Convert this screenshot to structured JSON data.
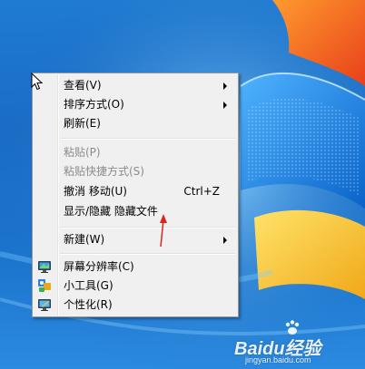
{
  "context_menu": {
    "items": [
      {
        "label": "查看(V)",
        "submenu": true
      },
      {
        "label": "排序方式(O)",
        "submenu": true
      },
      {
        "label": "刷新(E)"
      },
      {
        "label": "粘贴(P)",
        "disabled": true
      },
      {
        "label": "粘贴快捷方式(S)",
        "disabled": true
      },
      {
        "label": "撤消 移动(U)",
        "shortcut": "Ctrl+Z"
      },
      {
        "label": "显示/隐藏 隐藏文件"
      },
      {
        "label": "新建(W)",
        "submenu": true
      },
      {
        "label": "屏幕分辨率(C)",
        "icon": "screen-resolution-icon"
      },
      {
        "label": "小工具(G)",
        "icon": "gadgets-icon"
      },
      {
        "label": "个性化(R)",
        "icon": "personalize-icon"
      }
    ]
  },
  "watermark": {
    "brand": "Baidu经验",
    "url": "jingyan.baidu.com"
  },
  "colors": {
    "desktop_blue": "#1a6cc4",
    "annotation_red": "#d9261c",
    "menu_bg": "#f0f0f0"
  }
}
